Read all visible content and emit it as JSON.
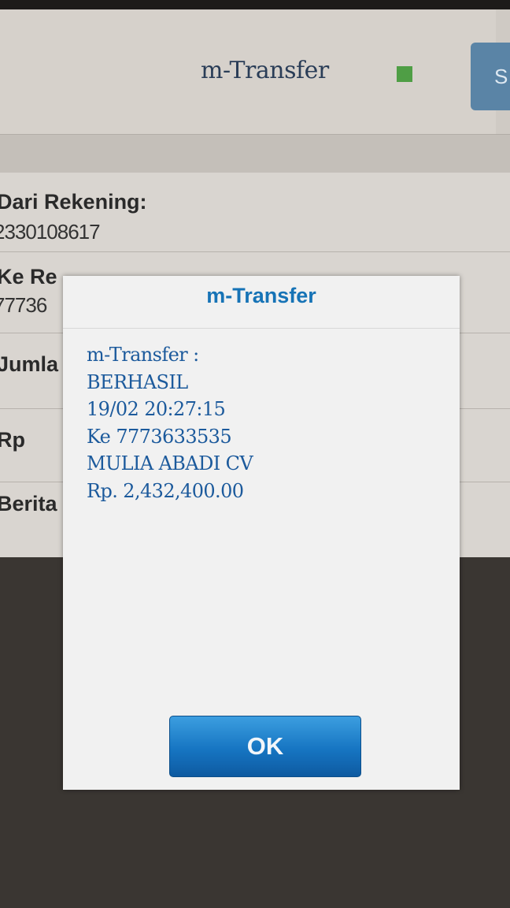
{
  "app": {
    "title": "m-Transfer",
    "send_label": "S"
  },
  "form": {
    "from_label": "Dari Rekening:",
    "from_value": "2330108617",
    "to_label": "Ke Re",
    "to_value": "77736",
    "amount_label": "Jumla",
    "currency_label": "Rp",
    "note_label": "Berita"
  },
  "dialog": {
    "title": "m-Transfer",
    "lines": [
      "m-Transfer :",
      "BERHASIL",
      "19/02 20:27:15",
      "Ke 7773633535",
      "MULIA ABADI CV",
      "Rp. 2,432,400.00"
    ],
    "ok_label": "OK"
  },
  "colors": {
    "accent": "#1673b6",
    "status_green": "#4f9e45"
  }
}
